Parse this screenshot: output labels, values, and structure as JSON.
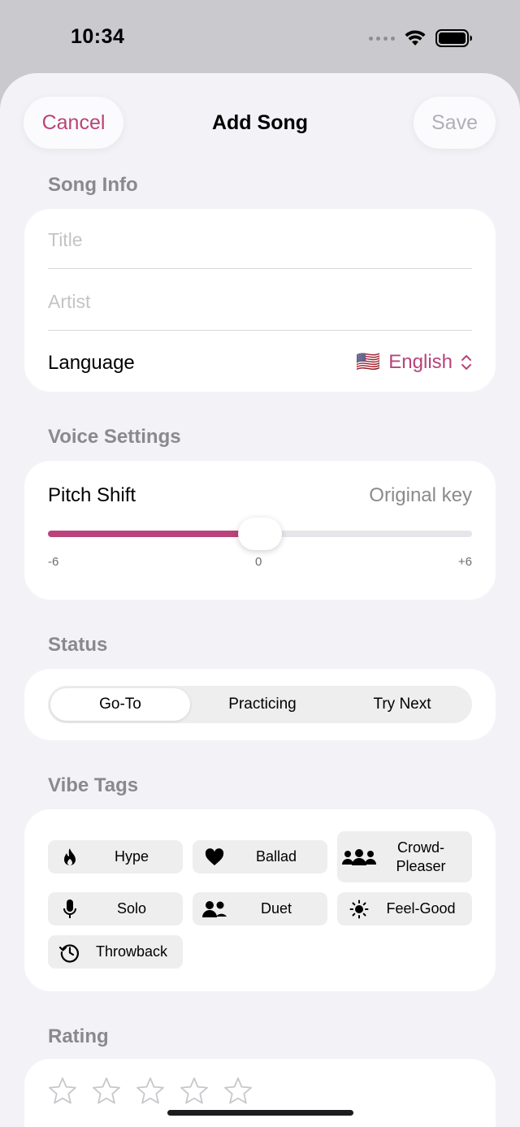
{
  "status_bar": {
    "time": "10:34"
  },
  "nav": {
    "cancel_label": "Cancel",
    "title": "Add Song",
    "save_label": "Save"
  },
  "song_info": {
    "header": "Song Info",
    "title_placeholder": "Title",
    "artist_placeholder": "Artist",
    "language_label": "Language",
    "language_flag": "🇺🇸",
    "language_value": "English"
  },
  "voice_settings": {
    "header": "Voice Settings",
    "pitch_label": "Pitch Shift",
    "pitch_value_text": "Original key",
    "slider": {
      "min": -6,
      "max": 6,
      "value": 0,
      "min_label": "-6",
      "mid_label": "0",
      "max_label": "+6"
    }
  },
  "status": {
    "header": "Status",
    "options": [
      "Go-To",
      "Practicing",
      "Try Next"
    ],
    "selected": "Go-To"
  },
  "vibe_tags": {
    "header": "Vibe Tags",
    "tags": [
      {
        "label": "Hype",
        "icon": "flame-icon"
      },
      {
        "label": "Ballad",
        "icon": "heart-icon"
      },
      {
        "label": "Crowd-\nPleaser",
        "icon": "group-icon"
      },
      {
        "label": "Solo",
        "icon": "microphone-icon"
      },
      {
        "label": "Duet",
        "icon": "two-people-icon"
      },
      {
        "label": "Feel-Good",
        "icon": "sun-icon"
      },
      {
        "label": "Throwback",
        "icon": "history-icon"
      }
    ]
  },
  "rating": {
    "header": "Rating",
    "value": 0,
    "max": 5
  },
  "colors": {
    "accent": "#b9437a",
    "background": "#f2f2f7",
    "card": "#ffffff"
  }
}
